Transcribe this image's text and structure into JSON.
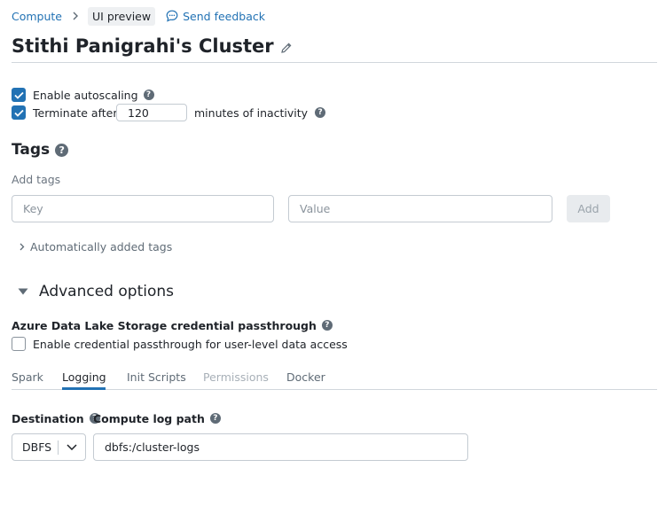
{
  "breadcrumb": {
    "compute": "Compute",
    "badge": "UI preview",
    "feedback": "Send feedback"
  },
  "title": "Stithi Panigrahi's Cluster",
  "autoscaling": {
    "label": "Enable autoscaling",
    "checked": true
  },
  "terminate": {
    "label_before": "Terminate after",
    "value": "120",
    "label_after": "minutes of inactivity",
    "checked": true
  },
  "tags": {
    "heading": "Tags",
    "add_label": "Add tags",
    "key_placeholder": "Key",
    "value_placeholder": "Value",
    "add_button": "Add",
    "auto_added": "Automatically added tags"
  },
  "advanced": {
    "heading": "Advanced options",
    "adls_heading": "Azure Data Lake Storage credential passthrough",
    "passthrough_label": "Enable credential passthrough for user-level data access",
    "passthrough_checked": false
  },
  "tabs": [
    {
      "label": "Spark",
      "state": "normal"
    },
    {
      "label": "Logging",
      "state": "active"
    },
    {
      "label": "Init Scripts",
      "state": "normal"
    },
    {
      "label": "Permissions",
      "state": "disabled"
    },
    {
      "label": "Docker",
      "state": "normal"
    }
  ],
  "logging": {
    "destination_label": "Destination",
    "destination_value": "DBFS",
    "log_path_label": "Compute log path",
    "log_path_value": "dbfs:/cluster-logs"
  },
  "colors": {
    "accent": "#2272b4",
    "text": "#1f2329",
    "muted": "#6b7580"
  }
}
